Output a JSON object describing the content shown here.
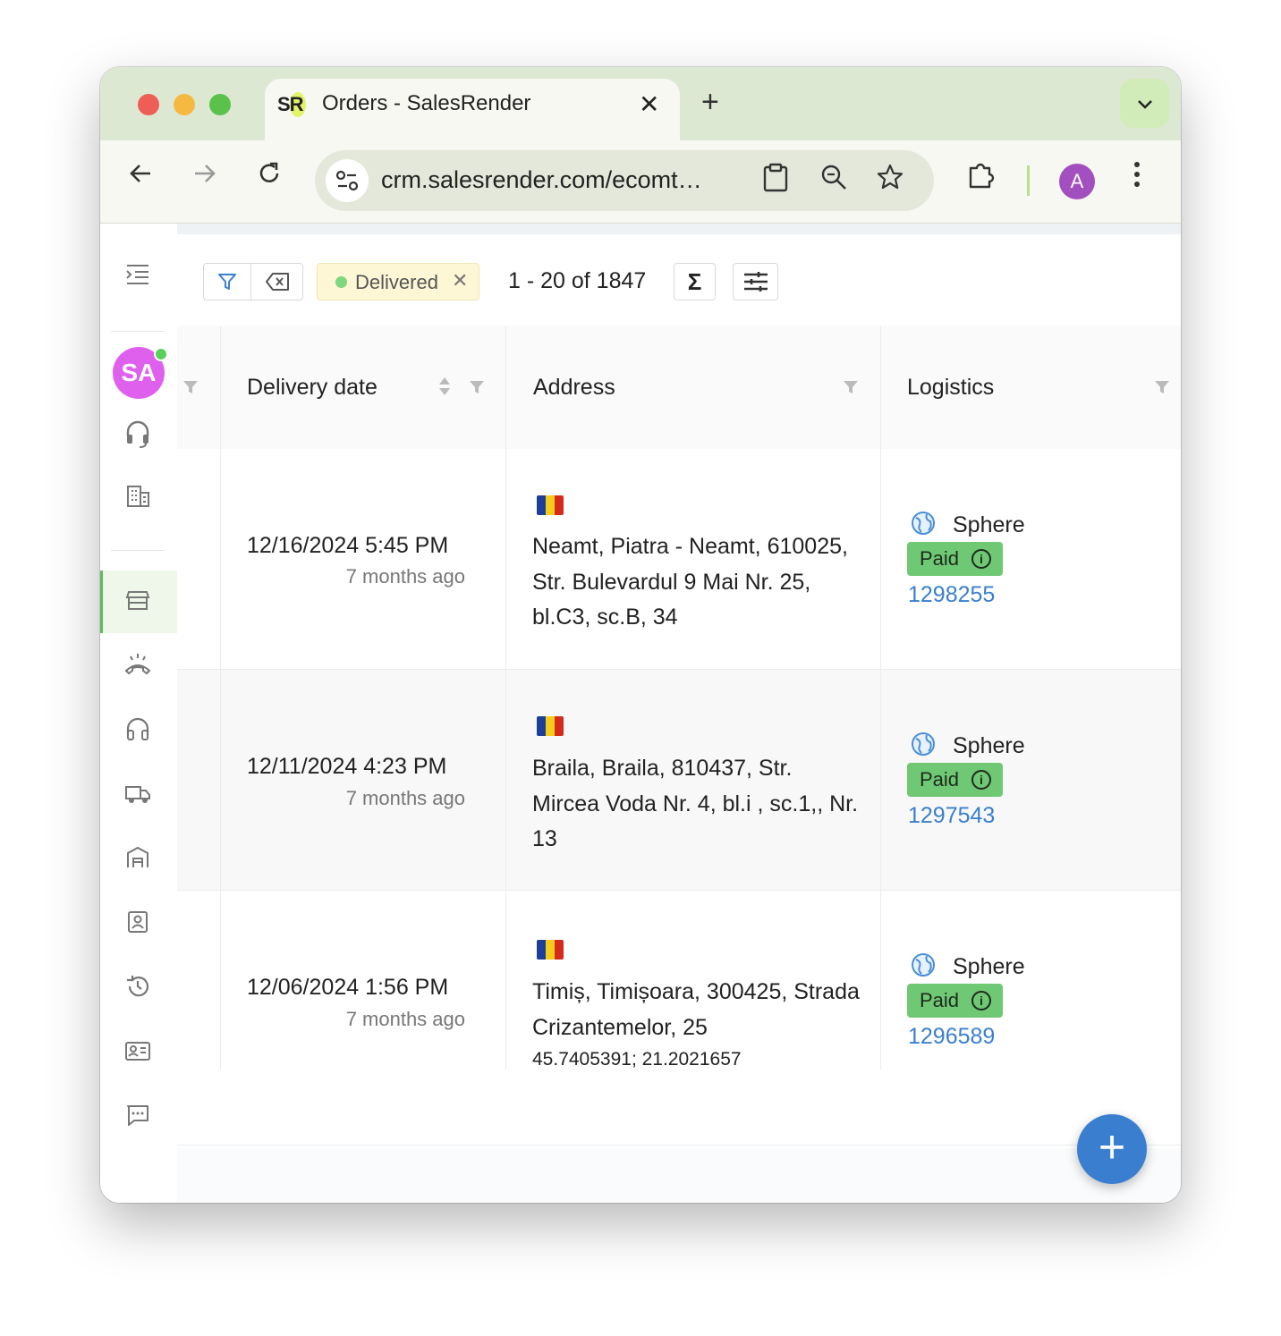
{
  "browser": {
    "tab_title": "Orders - SalesRender",
    "tab_favicon_text": "SR",
    "url": "crm.salesrender.com/ecomt…",
    "profile_initial": "A",
    "icons": [
      "back-icon",
      "forward-icon",
      "reload-icon",
      "site-settings-icon",
      "clipboard-icon",
      "zoom-icon",
      "star-icon",
      "extensions-icon",
      "more-icon"
    ]
  },
  "sidebar": {
    "user_initials": "SA",
    "online": true,
    "items": [
      "menu-toggle-icon",
      "headset-icon",
      "building-icon",
      "store-icon",
      "call-icon",
      "headphones-icon",
      "truck-icon",
      "warehouse-icon",
      "contact-icon",
      "history-icon",
      "id-card-icon",
      "chat-icon"
    ],
    "active_item": "store-icon",
    "accent_color": "#5bc05b"
  },
  "filters": {
    "chip_label": "Delivered",
    "chip_dot_color": "#7ed67e",
    "pagination": "1 - 20 of 1847"
  },
  "table": {
    "columns": {
      "delivery_date": "Delivery date",
      "address": "Address",
      "logistics": "Logistics"
    },
    "rows": [
      {
        "date": "12/16/2024 5:45 PM",
        "ago": "7 months ago",
        "country_flag": "RO",
        "address": "Neamt, Piatra - Neamt, 610025, Str. Bulevardul 9 Mai Nr. 25, bl.C3, sc.B, 34",
        "coords": "",
        "logistics_name": "Sphere",
        "payment_status": "Paid",
        "tracking": "1298255"
      },
      {
        "date": "12/11/2024 4:23 PM",
        "ago": "7 months ago",
        "country_flag": "RO",
        "address": "Braila, Braila, 810437, Str. Mircea Voda Nr. 4, bl.i , sc.1,, Nr. 13",
        "coords": "",
        "logistics_name": "Sphere",
        "payment_status": "Paid",
        "tracking": "1297543"
      },
      {
        "date": "12/06/2024 1:56 PM",
        "ago": "7 months ago",
        "country_flag": "RO",
        "address": "Timiș, Timișoara, 300425, Strada Crizantemelor, 25",
        "coords": "45.7405391; 21.2021657",
        "logistics_name": "Sphere",
        "payment_status": "Paid",
        "tracking": "1296589"
      }
    ]
  },
  "fab_label": "+",
  "colors": {
    "paid_badge": "#6fc873",
    "link": "#3a7fcf",
    "fab": "#3a7fcf"
  }
}
